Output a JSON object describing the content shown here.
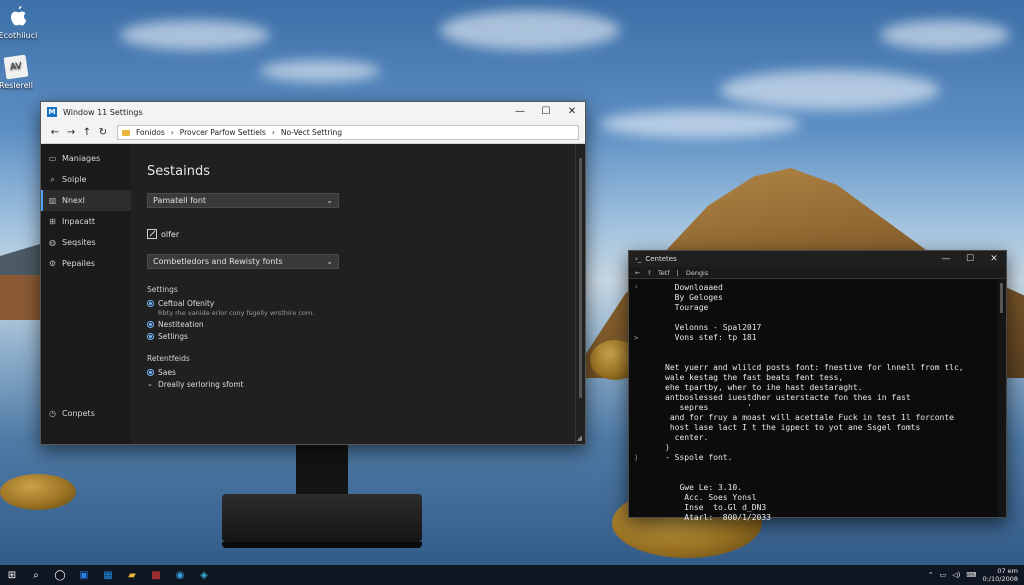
{
  "desktop": {
    "icons": [
      {
        "label": "Ecothiiuci",
        "icon": "apple-icon"
      },
      {
        "label": "Reslerell",
        "icon": "document-icon",
        "glyph": "AV"
      }
    ]
  },
  "settings_window": {
    "title": "Window 11 Settings",
    "controls": {
      "minimize": "—",
      "maximize": "☐",
      "close": "✕"
    },
    "address": {
      "back": "←",
      "forward": "→",
      "up": "↑",
      "refresh": "↻",
      "segments": [
        "Fonidos",
        "Provcer Parfow Settiels",
        "No-Vect Settring"
      ],
      "separator": "›"
    },
    "sidebar": {
      "items": [
        {
          "label": "Maniages",
          "icon": "home-icon",
          "glyph": "▭"
        },
        {
          "label": "Soiple",
          "icon": "search-icon",
          "glyph": "⌕"
        },
        {
          "label": "Nnexl",
          "icon": "font-icon",
          "glyph": "▥",
          "active": true
        },
        {
          "label": "Inpacatt",
          "icon": "grid-icon",
          "glyph": "⊞"
        },
        {
          "label": "Seqsites",
          "icon": "globe-icon",
          "glyph": "◍"
        },
        {
          "label": "Pepailes",
          "icon": "settings-icon",
          "glyph": "⚙"
        }
      ],
      "bottom": {
        "label": "Conpets",
        "icon": "clock-icon",
        "glyph": "◷"
      }
    },
    "content": {
      "heading": "Sestainds",
      "dropdown1": "Pamatell font",
      "checkbox_label": "olfer",
      "dropdown2": "Combetledors and Rewisty fonts",
      "settings_label": "Settings",
      "options": [
        {
          "label": "Ceftoal Ofenity",
          "sub": "Rbty rhe vanide erlor cony fsgelly wrsthire com."
        },
        {
          "label": "Nestiteation",
          "sub": ""
        },
        {
          "label": "Setlings",
          "sub": ""
        }
      ],
      "recent_label": "Retentfeids",
      "recent": [
        {
          "label": "Saes",
          "type": "radio"
        },
        {
          "label": "Dreally serloring sfomt",
          "type": "chevron"
        }
      ]
    }
  },
  "console_window": {
    "title": "Centetes",
    "controls": {
      "minimize": "—",
      "maximize": "☐",
      "close": "✕"
    },
    "toolbar": [
      "←",
      "?",
      "Tetf",
      "|",
      "Dengis"
    ],
    "gutter": [
      "¹",
      "",
      "",
      "",
      "",
      ">",
      "",
      "",
      "",
      "",
      "",
      "",
      "",
      "",
      "",
      "",
      "",
      ")"
    ],
    "lines": [
      "  Downloaaed",
      "  By Geloges",
      "  Tourage",
      "",
      "  Velonns - Spal2017",
      "  Vons stef: tp 181",
      "",
      "",
      "Net yuerr and wlilcd posts font: fnestive for lnnell from tlc,",
      "wale kestag the fast beats fent tess,",
      "ehe tpartby, wher to ihe hast destaraght.",
      "antboslessed iuestdher usterstacte fon thes in fast",
      "   sepres        '",
      " and for fruy a moast will acettale Fuck in test 1l forconte",
      " host lase lact I t the igpect to yot ane Ssgel fomts",
      "  center.",
      ")",
      "- Sspole font.",
      "",
      "",
      "   Gwe Le: 3.10.",
      "    Acc. Soes Yonsl",
      "    Inse  to.Gl d_DN3",
      "    Atarl:  800/1/2033"
    ]
  },
  "taskbar": {
    "icons": [
      {
        "name": "start-icon",
        "glyph": "⊞",
        "color": "#ffffff"
      },
      {
        "name": "search-icon",
        "glyph": "⌕",
        "color": "#ffffff"
      },
      {
        "name": "task-view-icon",
        "glyph": "◯",
        "color": "#ffffff"
      },
      {
        "name": "edge-icon",
        "glyph": "▣",
        "color": "#2b7de9"
      },
      {
        "name": "store-icon",
        "glyph": "▦",
        "color": "#1f8ce0"
      },
      {
        "name": "explorer-icon",
        "glyph": "▰",
        "color": "#e8b73a"
      },
      {
        "name": "app-red-icon",
        "glyph": "▩",
        "color": "#e03a3a"
      },
      {
        "name": "chrome-icon",
        "glyph": "◉",
        "color": "#3aa0e0"
      },
      {
        "name": "photos-icon",
        "glyph": "◈",
        "color": "#3ab0d0"
      }
    ],
    "tray": {
      "items": [
        "⌃",
        "▭",
        "◁)",
        "⌨"
      ],
      "time": "07 em",
      "date": "0:/10/2008"
    }
  }
}
